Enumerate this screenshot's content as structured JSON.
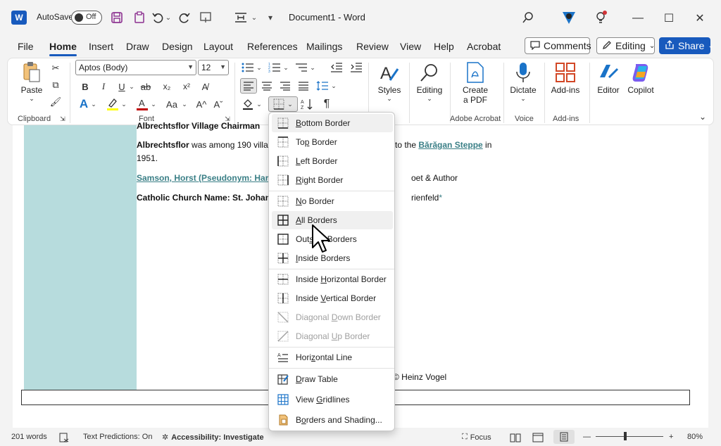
{
  "titlebar": {
    "app_logo": "W",
    "autosave_label": "AutoSave",
    "autosave_state": "Off",
    "document_title": "Document1  -  Word",
    "icons": [
      "save-icon",
      "undo-icon",
      "redo-icon",
      "touch-mode-icon",
      "table-layout-icon",
      "customize-icon",
      "search-icon",
      "designer-icon",
      "lightbulb-icon"
    ]
  },
  "tabs": [
    "File",
    "Home",
    "Insert",
    "Draw",
    "Design",
    "Layout",
    "References",
    "Mailings",
    "Review",
    "View",
    "Help",
    "Acrobat"
  ],
  "active_tab": "Home",
  "header_buttons": {
    "comments": "Comments",
    "editing": "Editing",
    "share": "Share"
  },
  "ribbon": {
    "clipboard": {
      "paste": "Paste",
      "label": "Clipboard"
    },
    "font": {
      "name": "Aptos (Body)",
      "size": "12",
      "label": "Font"
    },
    "styles": {
      "label": "Styles"
    },
    "editing": {
      "label": "Editing"
    },
    "adobe": {
      "create": "Create",
      "create2": "a PDF",
      "label": "Adobe Acrobat"
    },
    "voice": {
      "dictate": "Dictate",
      "label": "Voice"
    },
    "addins": {
      "button": "Add-ins",
      "label": "Add-ins"
    },
    "editor": "Editor",
    "copilot": "Copilot"
  },
  "document": {
    "line0": "Albrechtsflor Village Chairman",
    "line1_bold": "Albrechtsflor",
    "line1_rest": " was among 190 villa",
    "line1_tail": " to the ",
    "line1_link": "Bărăgan Steppe",
    "line1_end": " in",
    "line2": "1951.",
    "line3_link": "Samson, Horst (Pseudonym: Har",
    "line3_tail": "oet & Author",
    "line4_bold": "Catholic Church Name: St. Johan",
    "line4_tail": "rienfeld",
    "line4_star": "*",
    "credit": "© Heinz Vogel"
  },
  "border_menu": {
    "items": [
      {
        "pre": "",
        "u": "B",
        "post": "ottom Border",
        "icon": "bottom-border-icon",
        "state": "highlight"
      },
      {
        "pre": "To",
        "u": "p",
        "post": " Border",
        "icon": "top-border-icon",
        "state": ""
      },
      {
        "pre": "",
        "u": "L",
        "post": "eft Border",
        "icon": "left-border-icon",
        "state": ""
      },
      {
        "pre": "",
        "u": "R",
        "post": "ight Border",
        "icon": "right-border-icon",
        "state": ""
      },
      {
        "pre": "",
        "u": "N",
        "post": "o Border",
        "icon": "no-border-icon",
        "state": ""
      },
      {
        "pre": "",
        "u": "A",
        "post": "ll Borders",
        "icon": "all-borders-icon",
        "state": "hover"
      },
      {
        "pre": "Out",
        "u": "s",
        "post": "ide Borders",
        "icon": "outside-borders-icon",
        "state": ""
      },
      {
        "pre": "",
        "u": "I",
        "post": "nside Borders",
        "icon": "inside-borders-icon",
        "state": ""
      },
      {
        "pre": "Inside ",
        "u": "H",
        "post": "orizontal Border",
        "icon": "inside-horizontal-border-icon",
        "state": ""
      },
      {
        "pre": "Inside ",
        "u": "V",
        "post": "ertical Border",
        "icon": "inside-vertical-border-icon",
        "state": ""
      },
      {
        "pre": "Diagonal ",
        "u": "D",
        "post": "own Border",
        "icon": "diagonal-down-border-icon",
        "state": "disabled"
      },
      {
        "pre": "Diagonal ",
        "u": "U",
        "post": "p Border",
        "icon": "diagonal-up-border-icon",
        "state": "disabled"
      },
      {
        "pre": "Hori",
        "u": "z",
        "post": "ontal Line",
        "icon": "horizontal-line-icon",
        "state": ""
      },
      {
        "pre": "",
        "u": "D",
        "post": "raw Table",
        "icon": "draw-table-icon",
        "state": ""
      },
      {
        "pre": "View ",
        "u": "G",
        "post": "ridlines",
        "icon": "view-gridlines-icon",
        "state": ""
      },
      {
        "pre": "B",
        "u": "o",
        "post": "rders and Shading...",
        "icon": "borders-shading-icon",
        "state": ""
      }
    ]
  },
  "statusbar": {
    "words": "201 words",
    "text_predictions": "Text Predictions: On",
    "accessibility": "Accessibility: Investigate",
    "focus": "Focus",
    "zoom": "80%"
  },
  "colors": {
    "accent": "#185abd",
    "teal_column": "#b7dcdd",
    "link": "#3a7f86",
    "font_color_bar": "#c00000",
    "highlight_bar": "#ffff00"
  }
}
